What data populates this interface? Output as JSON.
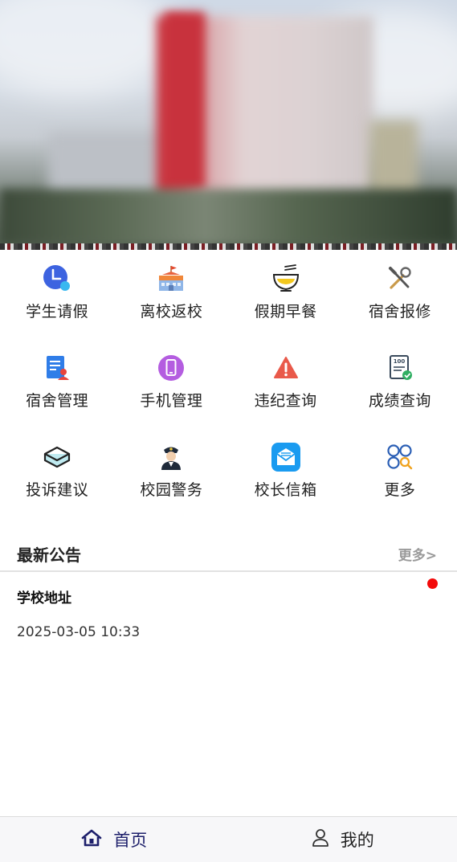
{
  "banner": {
    "image": "campus-building-photo"
  },
  "grid": [
    {
      "label": "学生请假",
      "icon": "clock-icon"
    },
    {
      "label": "离校返校",
      "icon": "school-building-icon"
    },
    {
      "label": "假期早餐",
      "icon": "bowl-icon"
    },
    {
      "label": "宿舍报修",
      "icon": "tools-icon"
    },
    {
      "label": "宿舍管理",
      "icon": "document-person-icon"
    },
    {
      "label": "手机管理",
      "icon": "phone-icon"
    },
    {
      "label": "违纪查询",
      "icon": "warning-icon"
    },
    {
      "label": "成绩查询",
      "icon": "score-report-icon"
    },
    {
      "label": "投诉建议",
      "icon": "graduation-cap-icon"
    },
    {
      "label": "校园警务",
      "icon": "police-officer-icon"
    },
    {
      "label": "校长信箱",
      "icon": "mailbox-icon"
    },
    {
      "label": "更多",
      "icon": "apps-icon"
    }
  ],
  "notice": {
    "title": "最新公告",
    "more": "更多>",
    "items": [
      {
        "title": "学校地址",
        "time": "2025-03-05 10:33",
        "unread": true
      }
    ]
  },
  "tabbar": {
    "home": "首页",
    "mine": "我的"
  },
  "colors": {
    "accent": "#1d1f6b",
    "unread_dot": "#f30a0a"
  }
}
